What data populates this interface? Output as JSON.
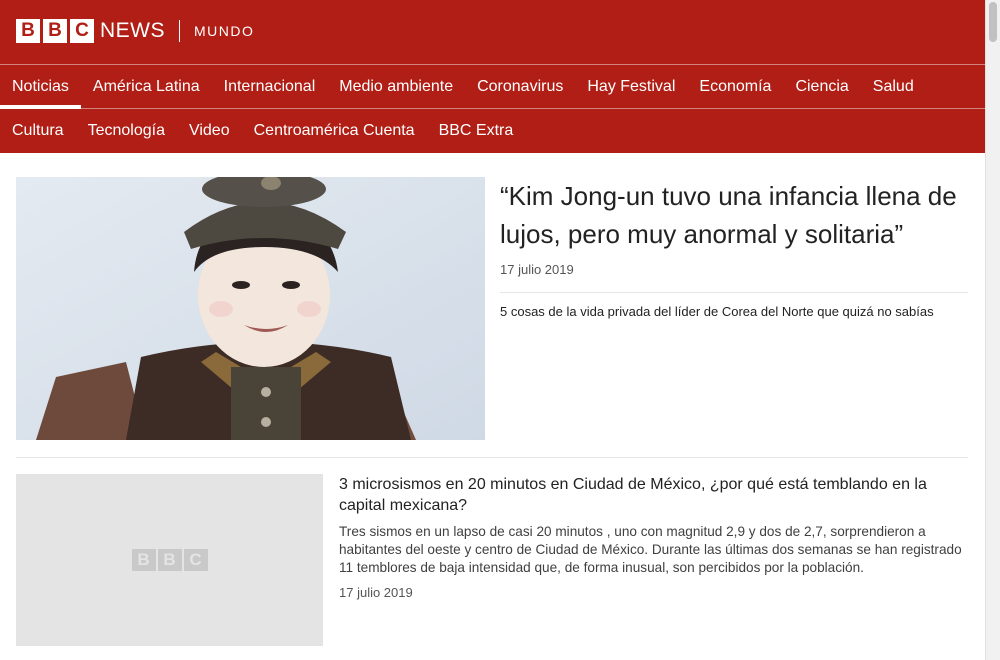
{
  "brand": {
    "logo_letters": [
      "B",
      "B",
      "C"
    ],
    "name": "NEWS",
    "edition": "MUNDO",
    "colors": {
      "header": "#b01e15"
    }
  },
  "nav": {
    "row1": [
      {
        "label": "Noticias",
        "active": true
      },
      {
        "label": "América Latina"
      },
      {
        "label": "Internacional"
      },
      {
        "label": "Medio ambiente"
      },
      {
        "label": "Coronavirus"
      },
      {
        "label": "Hay Festival"
      },
      {
        "label": "Economía"
      },
      {
        "label": "Ciencia"
      },
      {
        "label": "Salud"
      }
    ],
    "row2": [
      {
        "label": "Cultura"
      },
      {
        "label": "Tecnología"
      },
      {
        "label": "Video"
      },
      {
        "label": "Centroamérica Cuenta"
      },
      {
        "label": "BBC Extra"
      }
    ]
  },
  "stories": [
    {
      "title": "“Kim Jong-un tuvo una infancia llena de lujos, pero muy anormal y solitaria”",
      "date": "17 julio 2019",
      "related": "5 cosas de la vida privada del líder de Corea del Norte que quizá no sabías"
    },
    {
      "title": "3 microsismos en 20 minutos en Ciudad de México, ¿por qué está temblando en la capital mexicana?",
      "summary": "Tres sismos en un lapso de casi 20 minutos , uno con magnitud 2,9 y dos de 2,7, sorprendieron a habitantes del oeste y centro de Ciudad de México. Durante las últimas dos semanas se han registrado 11 temblores de baja intensidad que, de forma inusual, son percibidos por la población.",
      "date": "17 julio 2019",
      "placeholder_letters": [
        "B",
        "B",
        "C"
      ]
    }
  ]
}
